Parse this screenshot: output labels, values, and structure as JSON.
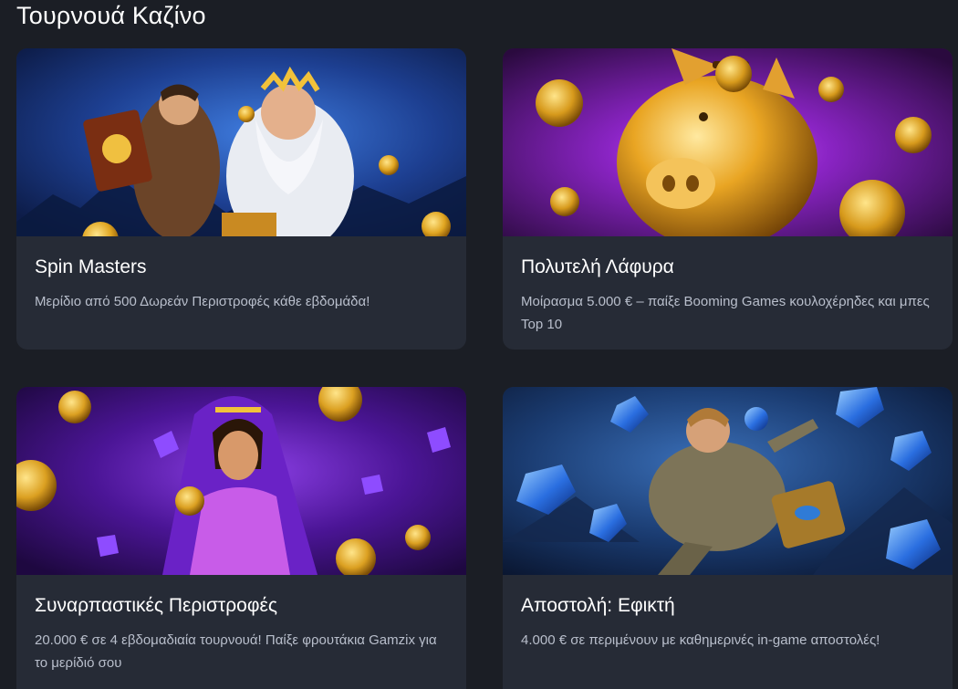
{
  "section": {
    "title": "Τουρνουά Καζίνο"
  },
  "cards": [
    {
      "title": "Spin Masters",
      "description": "Μερίδιο από 500 Δωρεάν Περιστροφές κάθε εβδομάδα!",
      "banner_theme": "zeus-explorer",
      "accent": "#1f4ea8"
    },
    {
      "title": "Πολυτελή Λάφυρα",
      "description": "Μοίρασμα 5.000 € – παίξε Booming Games κουλοχέρηδες και μπες Top 10",
      "banner_theme": "golden-piggy-bank",
      "accent": "#7a1fb0"
    },
    {
      "title": "Συναρπαστικές Περιστροφές",
      "description": "20.000 € σε 4 εβδομαδιαία τουρνουά! Παίξε φρουτάκια Gamzix για το μερίδιό σου",
      "banner_theme": "egyptian-queen",
      "accent": "#5a1aa8"
    },
    {
      "title": "Αποστολή: Εφικτή",
      "description": "4.000 € σε περιμένουν με καθημερινές in-game αποστολές!",
      "banner_theme": "explorer-diamonds",
      "accent": "#1c3f78"
    }
  ]
}
